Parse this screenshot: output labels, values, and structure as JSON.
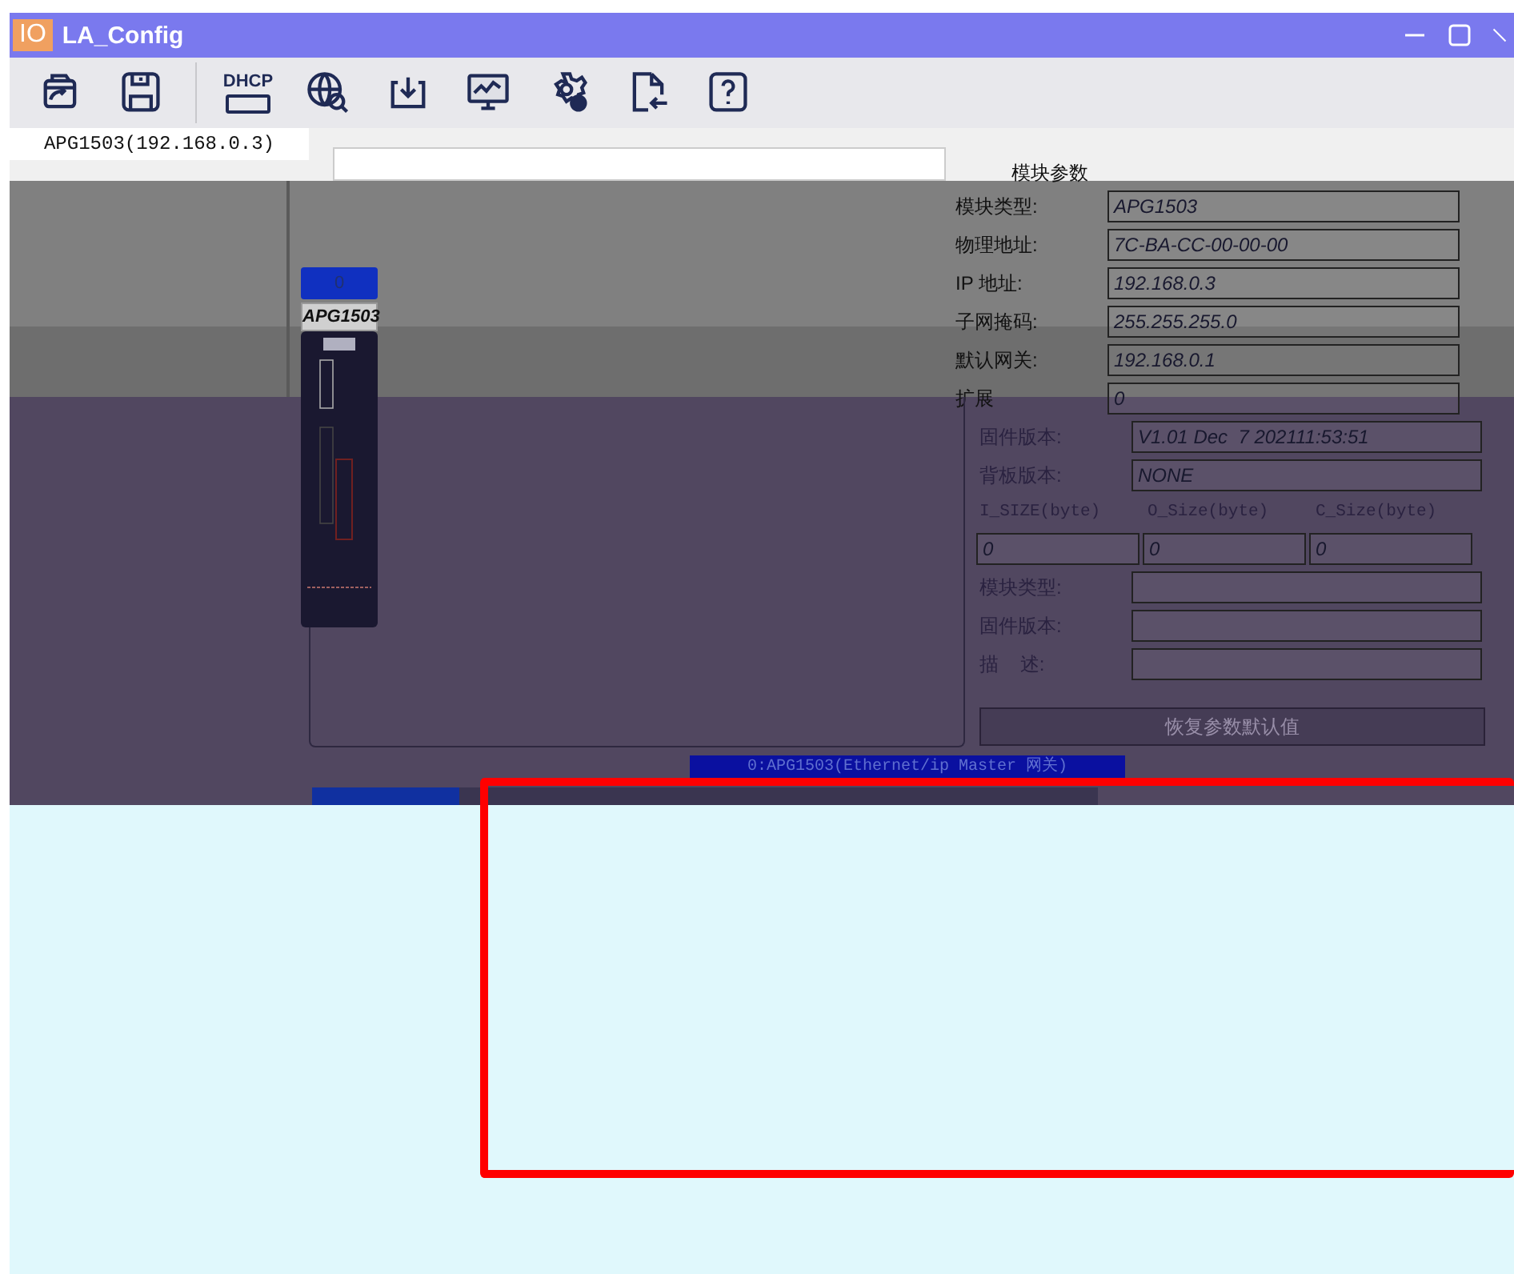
{
  "window": {
    "logo": "IO",
    "title": "LA_Config"
  },
  "toolbar": [
    {
      "kind": "open"
    },
    {
      "kind": "save"
    },
    {
      "kind": "dhcp",
      "label": "DHCP"
    },
    {
      "kind": "scan"
    },
    {
      "kind": "download"
    },
    {
      "kind": "monitor"
    },
    {
      "kind": "settings"
    },
    {
      "kind": "import"
    },
    {
      "kind": "help"
    }
  ],
  "tabs": [
    {
      "label": "APG1503(192.168.0.3)",
      "selected": true
    }
  ],
  "device": {
    "slot": "0",
    "model": "APG1503"
  },
  "params": {
    "title": "模块参数",
    "fields": [
      {
        "label": "模块类型:",
        "value": "APG1503"
      },
      {
        "label": "物理地址:",
        "value": "7C-BA-CC-00-00-00"
      },
      {
        "label": "IP 地址:",
        "value": "192.168.0.3"
      },
      {
        "label": "子网掩码:",
        "value": "255.255.255.0"
      },
      {
        "label": "默认网关:",
        "value": "192.168.0.1"
      },
      {
        "label": "扩展",
        "value": "0"
      },
      {
        "label": "固件版本:",
        "value": "V1.01 Dec  7 202111:53:51"
      },
      {
        "label": "背板版本:",
        "value": "NONE"
      }
    ],
    "sizes": [
      {
        "label": "I_SIZE(byte)",
        "value": "0"
      },
      {
        "label": "O_Size(byte)",
        "value": "0"
      },
      {
        "label": "C_Size(byte)",
        "value": "0"
      }
    ],
    "extra_fields": [
      {
        "label": "模块类型:"
      },
      {
        "label": "固件版本:"
      },
      {
        "label": "描    述:"
      }
    ],
    "reset_button": "恢复参数默认值"
  },
  "status": "0:APG1503(Ethernet/ip Master 网关)"
}
